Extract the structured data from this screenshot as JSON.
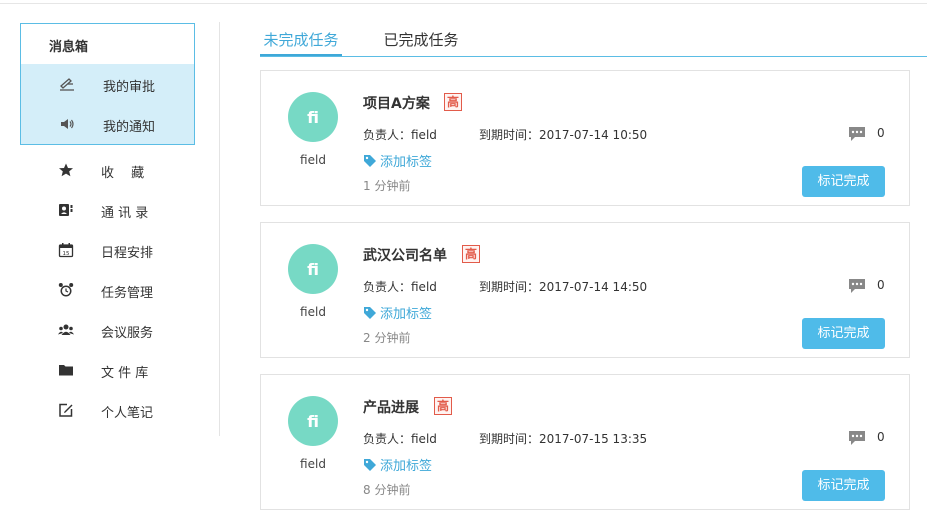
{
  "sidebar": {
    "msgbox_title": "消息箱",
    "msg_items": [
      {
        "label": "我的审批",
        "icon": "approval-pen-icon"
      },
      {
        "label": "我的通知",
        "icon": "speaker-icon"
      }
    ],
    "nav_items": [
      {
        "label": "收　 藏",
        "icon": "star-icon"
      },
      {
        "label": "通 讯 录",
        "icon": "contacts-icon"
      },
      {
        "label": "日程安排",
        "icon": "calendar-icon"
      },
      {
        "label": "任务管理",
        "icon": "alarm-clock-icon"
      },
      {
        "label": "会议服务",
        "icon": "group-icon"
      },
      {
        "label": "文 件 库",
        "icon": "folder-icon"
      },
      {
        "label": "个人笔记",
        "icon": "edit-note-icon"
      }
    ]
  },
  "tabs": [
    {
      "label": "未完成任务",
      "active": true
    },
    {
      "label": "已完成任务",
      "active": false
    }
  ],
  "tasks": [
    {
      "avatar_text": "fi",
      "avatar_name": "field",
      "title": "项目A方案",
      "priority": "高",
      "owner": "负责人：field",
      "due": "到期时间：2017-07-14 10:50",
      "comment_count": "0",
      "tag_label": "添加标签",
      "time_ago": "1 分钟前",
      "button_label": "标记完成"
    },
    {
      "avatar_text": "fi",
      "avatar_name": "field",
      "title": "武汉公司名单",
      "priority": "高",
      "owner": "负责人：field",
      "due": "到期时间：2017-07-14 14:50",
      "comment_count": "0",
      "tag_label": "添加标签",
      "time_ago": "2 分钟前",
      "button_label": "标记完成"
    },
    {
      "avatar_text": "fi",
      "avatar_name": "field",
      "title": "产品进展",
      "priority": "高",
      "owner": "负责人：field",
      "due": "到期时间：2017-07-15 13:35",
      "comment_count": "0",
      "tag_label": "添加标签",
      "time_ago": "8 分钟前",
      "button_label": "标记完成"
    }
  ],
  "colors": {
    "accent": "#3fa8d8",
    "button": "#4fbbe9",
    "avatar": "#77d9c5",
    "priority": "#e25b4a",
    "msg_highlight": "#d4eef9"
  }
}
